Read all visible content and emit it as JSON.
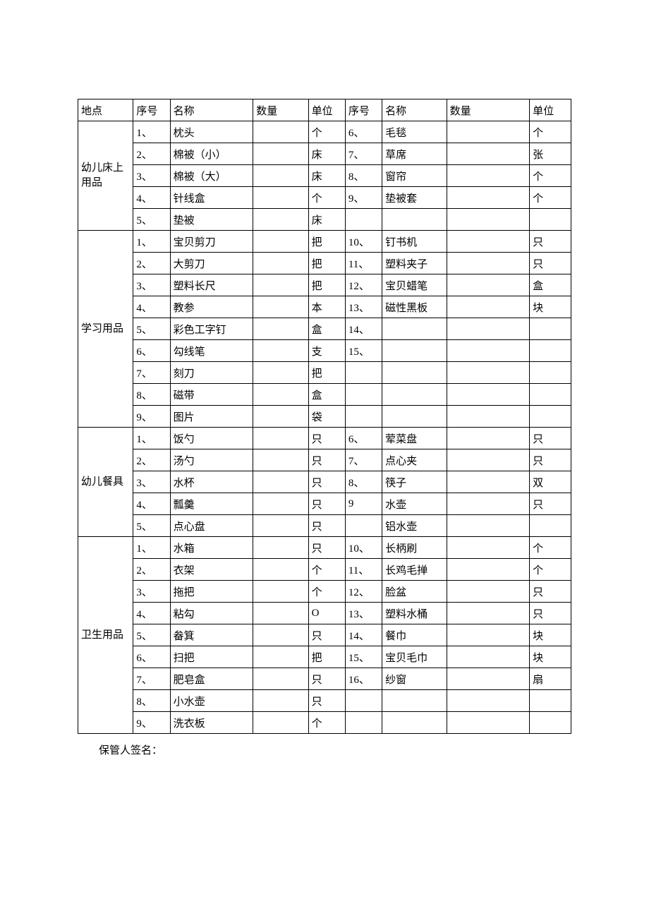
{
  "headers": {
    "loc": "地点",
    "seq": "序号",
    "name": "名称",
    "qty": "数量",
    "unit": "单位",
    "seq2": "序号",
    "name2": "名称",
    "qty2": "数量",
    "unit2": "单位"
  },
  "sections": [
    {
      "loc": "幼儿床上用品",
      "rows": [
        {
          "seq": "1、",
          "name": "枕头",
          "qty": "",
          "unit": "个",
          "seq2": "6、",
          "name2": "毛毯",
          "qty2": "",
          "unit2": "个",
          "tall": false
        },
        {
          "seq": "2、",
          "name": "棉被（小）",
          "qty": "",
          "unit": "床",
          "seq2": "7、",
          "name2": "草席",
          "qty2": "",
          "unit2": "张",
          "tall": true
        },
        {
          "seq": "3、",
          "name": "棉被（大）",
          "qty": "",
          "unit": "床",
          "seq2": "8、",
          "name2": "窗帘",
          "qty2": "",
          "unit2": "个",
          "tall": true
        },
        {
          "seq": "4、",
          "name": "针线盒",
          "qty": "",
          "unit": "个",
          "seq2": "9、",
          "name2": "垫被套",
          "qty2": "",
          "unit2": "个",
          "tall": false
        },
        {
          "seq": "5、",
          "name": "垫被",
          "qty": "",
          "unit": "床",
          "seq2": "",
          "name2": "",
          "qty2": "",
          "unit2": "",
          "tall": false
        }
      ]
    },
    {
      "loc": "学习用品",
      "rows": [
        {
          "seq": "1、",
          "name": "宝贝剪刀",
          "qty": "",
          "unit": "把",
          "seq2": "10、",
          "name2": "钉书机",
          "qty2": "",
          "unit2": "只",
          "tall": true
        },
        {
          "seq": "2、",
          "name": "大剪刀",
          "qty": "",
          "unit": "把",
          "seq2": "11、",
          "name2": "塑料夹子",
          "qty2": "",
          "unit2": "只",
          "tall": true
        },
        {
          "seq": "3、",
          "name": "塑料长尺",
          "qty": "",
          "unit": "把",
          "seq2": "12、",
          "name2": "宝贝蜡笔",
          "qty2": "",
          "unit2": "盒",
          "tall": true
        },
        {
          "seq": "4、",
          "name": "教参",
          "qty": "",
          "unit": "本",
          "seq2": "13、",
          "name2": "磁性黑板",
          "qty2": "",
          "unit2": "块",
          "tall": true
        },
        {
          "seq": "5、",
          "name": "彩色工字钉",
          "qty": "",
          "unit": "盒",
          "seq2": "14、",
          "name2": "",
          "qty2": "",
          "unit2": "",
          "tall": true
        },
        {
          "seq": "6、",
          "name": "勾线笔",
          "qty": "",
          "unit": "支",
          "seq2": "15、",
          "name2": "",
          "qty2": "",
          "unit2": "",
          "tall": true
        },
        {
          "seq": "7、",
          "name": "刻刀",
          "qty": "",
          "unit": "把",
          "seq2": "",
          "name2": "",
          "qty2": "",
          "unit2": "",
          "tall": true
        },
        {
          "seq": "8、",
          "name": "磁带",
          "qty": "",
          "unit": "盒",
          "seq2": "",
          "name2": "",
          "qty2": "",
          "unit2": "",
          "tall": true
        },
        {
          "seq": "9、",
          "name": "图片",
          "qty": "",
          "unit": "袋",
          "seq2": "",
          "name2": "",
          "qty2": "",
          "unit2": "",
          "tall": true
        }
      ]
    },
    {
      "loc": "幼儿餐具",
      "rows": [
        {
          "seq": "1、",
          "name": "饭勺",
          "qty": "",
          "unit": "只",
          "seq2": "6、",
          "name2": "荤菜盘",
          "qty2": "",
          "unit2": "只",
          "tall": false
        },
        {
          "seq": "2、",
          "name": "汤勺",
          "qty": "",
          "unit": "只",
          "seq2": "7、",
          "name2": "点心夹",
          "qty2": "",
          "unit2": "只",
          "tall": false
        },
        {
          "seq": "3、",
          "name": "水杯",
          "qty": "",
          "unit": "只",
          "seq2": "8、",
          "name2": "筷子",
          "qty2": "",
          "unit2": "双",
          "tall": true
        },
        {
          "seq": "4、",
          "name": "瓢羹",
          "qty": "",
          "unit": "只",
          "seq2": "9",
          "name2": "水壶",
          "qty2": "",
          "unit2": "只",
          "tall": false
        },
        {
          "seq": "5、",
          "name": "点心盘",
          "qty": "",
          "unit": "只",
          "seq2": "",
          "name2": "铝水壶",
          "qty2": "",
          "unit2": "",
          "tall": true
        }
      ]
    },
    {
      "loc": "卫生用品",
      "rows": [
        {
          "seq": "1、",
          "name": "水箱",
          "qty": "",
          "unit": "只",
          "seq2": "10、",
          "name2": "长柄刷",
          "qty2": "",
          "unit2": "个",
          "tall": true
        },
        {
          "seq": "2、",
          "name": "衣架",
          "qty": "",
          "unit": "个",
          "seq2": "11、",
          "name2": "长鸡毛掸",
          "qty2": "",
          "unit2": "个",
          "tall": true
        },
        {
          "seq": "3、",
          "name": "拖把",
          "qty": "",
          "unit": "个",
          "seq2": "12、",
          "name2": "脸盆",
          "qty2": "",
          "unit2": "只",
          "tall": true
        },
        {
          "seq": "4、",
          "name": "粘勾",
          "qty": "",
          "unit": "O",
          "seq2": "13、",
          "name2": "塑料水桶",
          "qty2": "",
          "unit2": "只",
          "tall": true
        },
        {
          "seq": "5、",
          "name": "畚箕",
          "qty": "",
          "unit": "只",
          "seq2": "14、",
          "name2": "餐巾",
          "qty2": "",
          "unit2": "块",
          "tall": true
        },
        {
          "seq": "6、",
          "name": "扫把",
          "qty": "",
          "unit": "把",
          "seq2": "15、",
          "name2": "宝贝毛巾",
          "qty2": "",
          "unit2": "块",
          "tall": true
        },
        {
          "seq": "7、",
          "name": "肥皂盒",
          "qty": "",
          "unit": "只",
          "seq2": "16、",
          "name2": "纱窗",
          "qty2": "",
          "unit2": "扇",
          "tall": true
        },
        {
          "seq": "8、",
          "name": "小水壶",
          "qty": "",
          "unit": "只",
          "seq2": "",
          "name2": "",
          "qty2": "",
          "unit2": "",
          "tall": true
        },
        {
          "seq": "9、",
          "name": "洗衣板",
          "qty": "",
          "unit": "个",
          "seq2": "",
          "name2": "",
          "qty2": "",
          "unit2": "",
          "tall": true
        }
      ]
    }
  ],
  "signature": "保管人签名："
}
